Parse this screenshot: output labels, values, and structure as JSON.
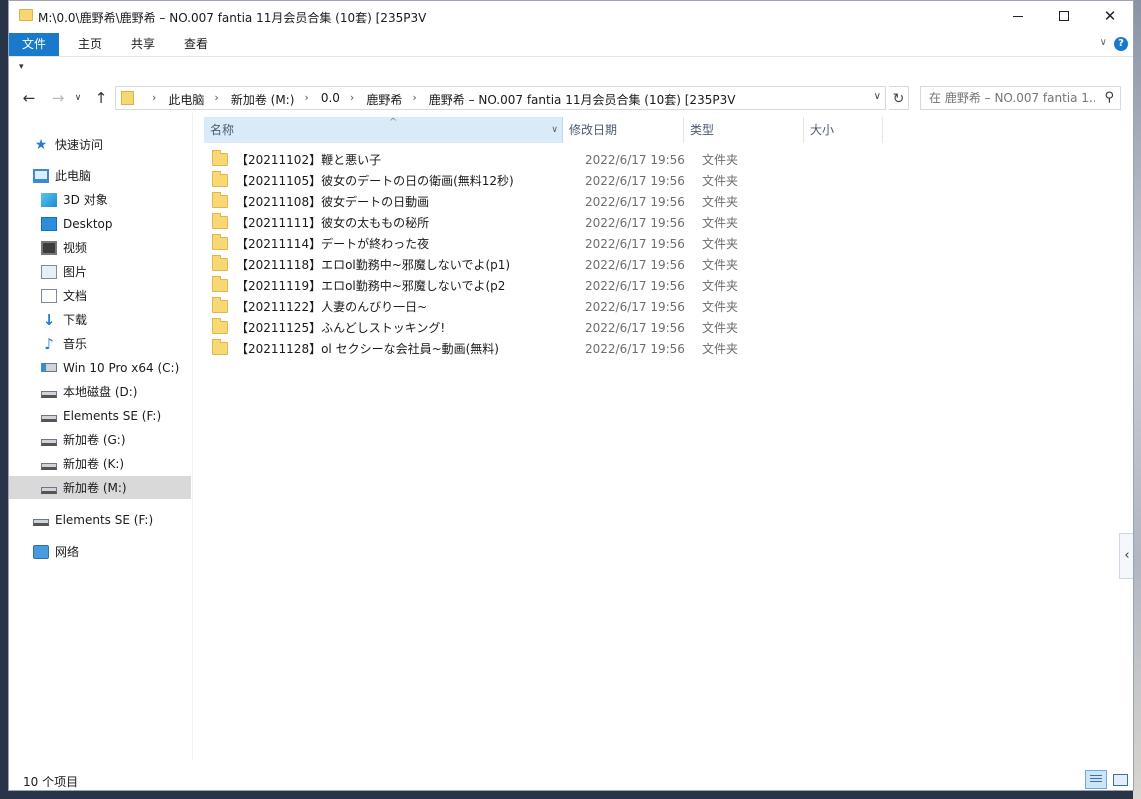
{
  "window": {
    "title": "M:\\0.0\\鹿野希\\鹿野希 – NO.007 fantia 11月会员合集 (10套) [235P3V"
  },
  "ribbon": {
    "tabs": [
      {
        "label": "文件",
        "active": true
      },
      {
        "label": "主页",
        "active": false
      },
      {
        "label": "共享",
        "active": false
      },
      {
        "label": "查看",
        "active": false
      }
    ]
  },
  "address": {
    "crumbs": [
      "此电脑",
      "新加卷 (M:)",
      "0.0",
      "鹿野希",
      "鹿野希 – NO.007 fantia 11月会员合集 (10套) [235P3V"
    ]
  },
  "search": {
    "placeholder": "在 鹿野希 – NO.007 fantia 1..."
  },
  "nav": {
    "items": [
      {
        "label": "快速访问",
        "icon": "star-icon",
        "indent": 0
      },
      {
        "label": "此电脑",
        "icon": "computer-icon",
        "indent": 0
      },
      {
        "label": "3D 对象",
        "icon": "3d-objects-icon",
        "indent": 1
      },
      {
        "label": "Desktop",
        "icon": "desktop-icon",
        "indent": 1
      },
      {
        "label": "视频",
        "icon": "video-icon",
        "indent": 1
      },
      {
        "label": "图片",
        "icon": "pictures-icon",
        "indent": 1
      },
      {
        "label": "文档",
        "icon": "documents-icon",
        "indent": 1
      },
      {
        "label": "下载",
        "icon": "downloads-icon",
        "indent": 1
      },
      {
        "label": "音乐",
        "icon": "music-icon",
        "indent": 1
      },
      {
        "label": "Win 10 Pro x64 (C:)",
        "icon": "system-drive-icon",
        "indent": 1
      },
      {
        "label": "本地磁盘 (D:)",
        "icon": "drive-icon",
        "indent": 1
      },
      {
        "label": "Elements SE (F:)",
        "icon": "drive-icon",
        "indent": 1
      },
      {
        "label": "新加卷 (G:)",
        "icon": "drive-icon",
        "indent": 1
      },
      {
        "label": "新加卷 (K:)",
        "icon": "drive-icon",
        "indent": 1
      },
      {
        "label": "新加卷 (M:)",
        "icon": "drive-icon",
        "indent": 1,
        "selected": true
      },
      {
        "label": "Elements SE (F:)",
        "icon": "drive-icon",
        "indent": 0
      },
      {
        "label": "网络",
        "icon": "network-icon",
        "indent": 0
      }
    ]
  },
  "columns": {
    "name": "名称",
    "date": "修改日期",
    "type": "类型",
    "size": "大小"
  },
  "files": [
    {
      "name": "【20211102】鞭と悪い子",
      "date": "2022/6/17 19:56",
      "type": "文件夹"
    },
    {
      "name": "【20211105】彼女のデートの日の衛画(無料12秒)",
      "date": "2022/6/17 19:56",
      "type": "文件夹"
    },
    {
      "name": "【20211108】彼女デートの日動画",
      "date": "2022/6/17 19:56",
      "type": "文件夹"
    },
    {
      "name": "【20211111】彼女の太ももの秘所",
      "date": "2022/6/17 19:56",
      "type": "文件夹"
    },
    {
      "name": "【20211114】デートが終わった夜",
      "date": "2022/6/17 19:56",
      "type": "文件夹"
    },
    {
      "name": "【20211118】エロol勤務中~邪魔しないでよ(p1)",
      "date": "2022/6/17 19:56",
      "type": "文件夹"
    },
    {
      "name": "【20211119】エロol勤務中~邪魔しないでよ(p2",
      "date": "2022/6/17 19:56",
      "type": "文件夹"
    },
    {
      "name": "【20211122】人妻のんびり一日~",
      "date": "2022/6/17 19:56",
      "type": "文件夹"
    },
    {
      "name": "【20211125】ふんどしストッキング!",
      "date": "2022/6/17 19:56",
      "type": "文件夹"
    },
    {
      "name": "【20211128】ol セクシーな会社員~動画(無料)",
      "date": "2022/6/17 19:56",
      "type": "文件夹"
    }
  ],
  "status": {
    "item_count": "10 个项目"
  },
  "colors": {
    "accent": "#1979ca",
    "folder": "#f8d775",
    "header_active": "#d9ebf9"
  }
}
